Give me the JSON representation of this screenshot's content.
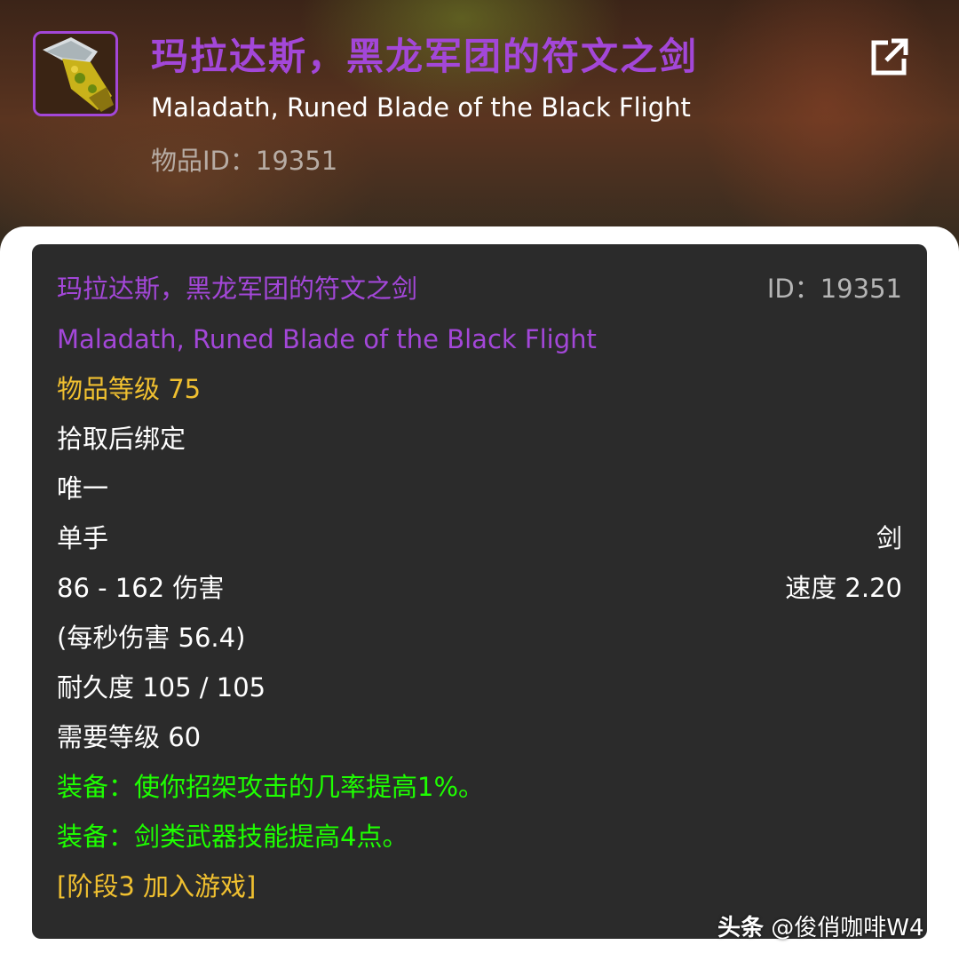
{
  "header": {
    "item_name_cn": "玛拉达斯，黑龙军团的符文之剑",
    "item_name_en": "Maladath, Runed Blade of the Black Flight",
    "item_id_label": "物品ID：",
    "item_id": "19351",
    "icon": "sword-item-icon",
    "share_icon": "external-link-icon"
  },
  "tooltip": {
    "name_cn": "玛拉达斯，黑龙军团的符文之剑",
    "id_label": "ID：",
    "id": "19351",
    "name_en": "Maladath, Runed Blade of the Black Flight",
    "item_level": "物品等级 75",
    "binding": "拾取后绑定",
    "unique": "唯一",
    "slot": "单手",
    "type": "剑",
    "damage": "86 - 162 伤害",
    "speed": "速度 2.20",
    "dps": "(每秒伤害 56.4)",
    "durability": "耐久度 105 / 105",
    "required_level": "需要等级 60",
    "equip_1": "装备：使你招架攻击的几率提高1%。",
    "equip_2": "装备：剑类武器技能提高4点。",
    "phase": "[阶段3 加入游戏]"
  },
  "watermark": {
    "brand": "头条",
    "author": "@俊俏咖啡W4"
  },
  "colors": {
    "epic_purple": "#a347d8",
    "gold": "#f0c030",
    "equip_green": "#1eff00",
    "tooltip_bg": "#2b2b2b"
  }
}
